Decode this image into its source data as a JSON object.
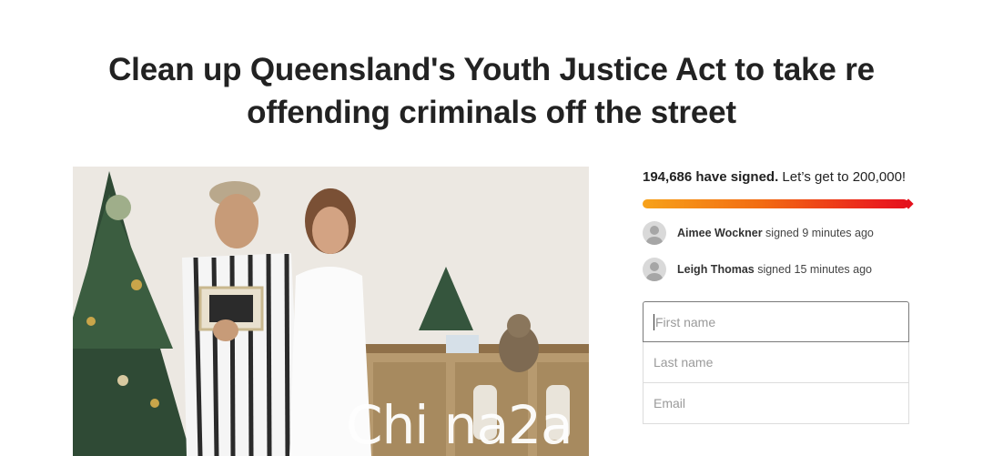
{
  "petition": {
    "title": "Clean up Queensland's Youth Justice Act to take re offending criminals off the street"
  },
  "progress": {
    "signed_count": "194,686 have signed.",
    "goal_text": " Let’s get to 200,000!",
    "fraction": 0.973
  },
  "recent_signers": [
    {
      "name": "Aimee Wockner",
      "action": " signed 9 minutes ago"
    },
    {
      "name": "Leigh Thomas",
      "action": " signed 15 minutes ago"
    }
  ],
  "form": {
    "first_name_placeholder": "First name",
    "last_name_placeholder": "Last name",
    "email_placeholder": "Email"
  },
  "watermark": "Chi na2a"
}
